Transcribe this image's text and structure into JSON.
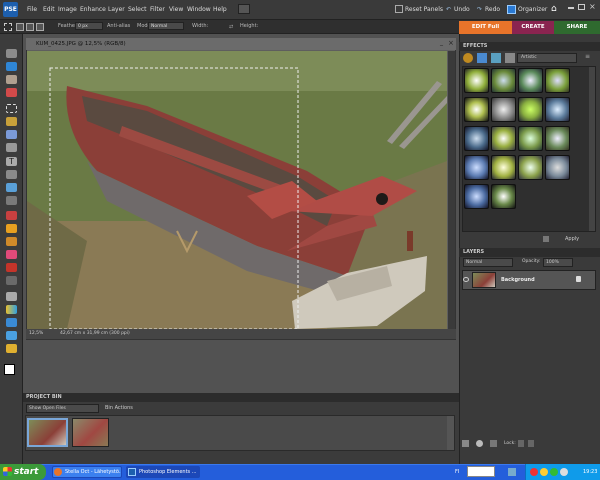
{
  "app": {
    "logo": "PSE",
    "window_title": "KUM_0425.JPG @ 12,5% (RGB/8)"
  },
  "menu": [
    "File",
    "Edit",
    "Image",
    "Enhance",
    "Layer",
    "Select",
    "Filter",
    "View",
    "Window",
    "Help"
  ],
  "top_actions": {
    "reset_panels": "Reset Panels",
    "undo": "Undo",
    "redo": "Redo",
    "organizer": "Organizer"
  },
  "options_bar": {
    "feather_label": "Feather:",
    "feather_value": "0 px",
    "anti_alias": "Anti-alias",
    "mode_label": "Mode:",
    "mode_value": "Normal",
    "width_label": "Width:",
    "height_label": "Height:"
  },
  "mode_tabs": {
    "edit_full": "EDIT Full",
    "create": "CREATE",
    "share": "SHARE"
  },
  "status": {
    "zoom": "12,5%",
    "doc_size": "42,67 cm x 31,99 cm (300 ppi)"
  },
  "bin": {
    "title": "PROJECT BIN",
    "show_label": "Show Open Files",
    "actions_label": "Bin Actions"
  },
  "effects": {
    "title": "EFFECTS",
    "category": "Artistic",
    "apply": "Apply",
    "count": 18
  },
  "layers": {
    "title": "LAYERS",
    "blend_mode": "Normal",
    "opacity_label": "Opacity:",
    "opacity_value": "100%",
    "layer_name": "Background",
    "lock_label": "Lock:"
  },
  "taskbar": {
    "start": "start",
    "tasks": [
      "Stella Oct - Lähetystö...",
      "Photoshop Elements ..."
    ],
    "language": "FI",
    "clock": "19:23"
  },
  "colors": {
    "accent": "#e8742a",
    "create_tab": "#8a2450",
    "share_tab": "#2f6a2f",
    "taskbar": "#245edb"
  }
}
